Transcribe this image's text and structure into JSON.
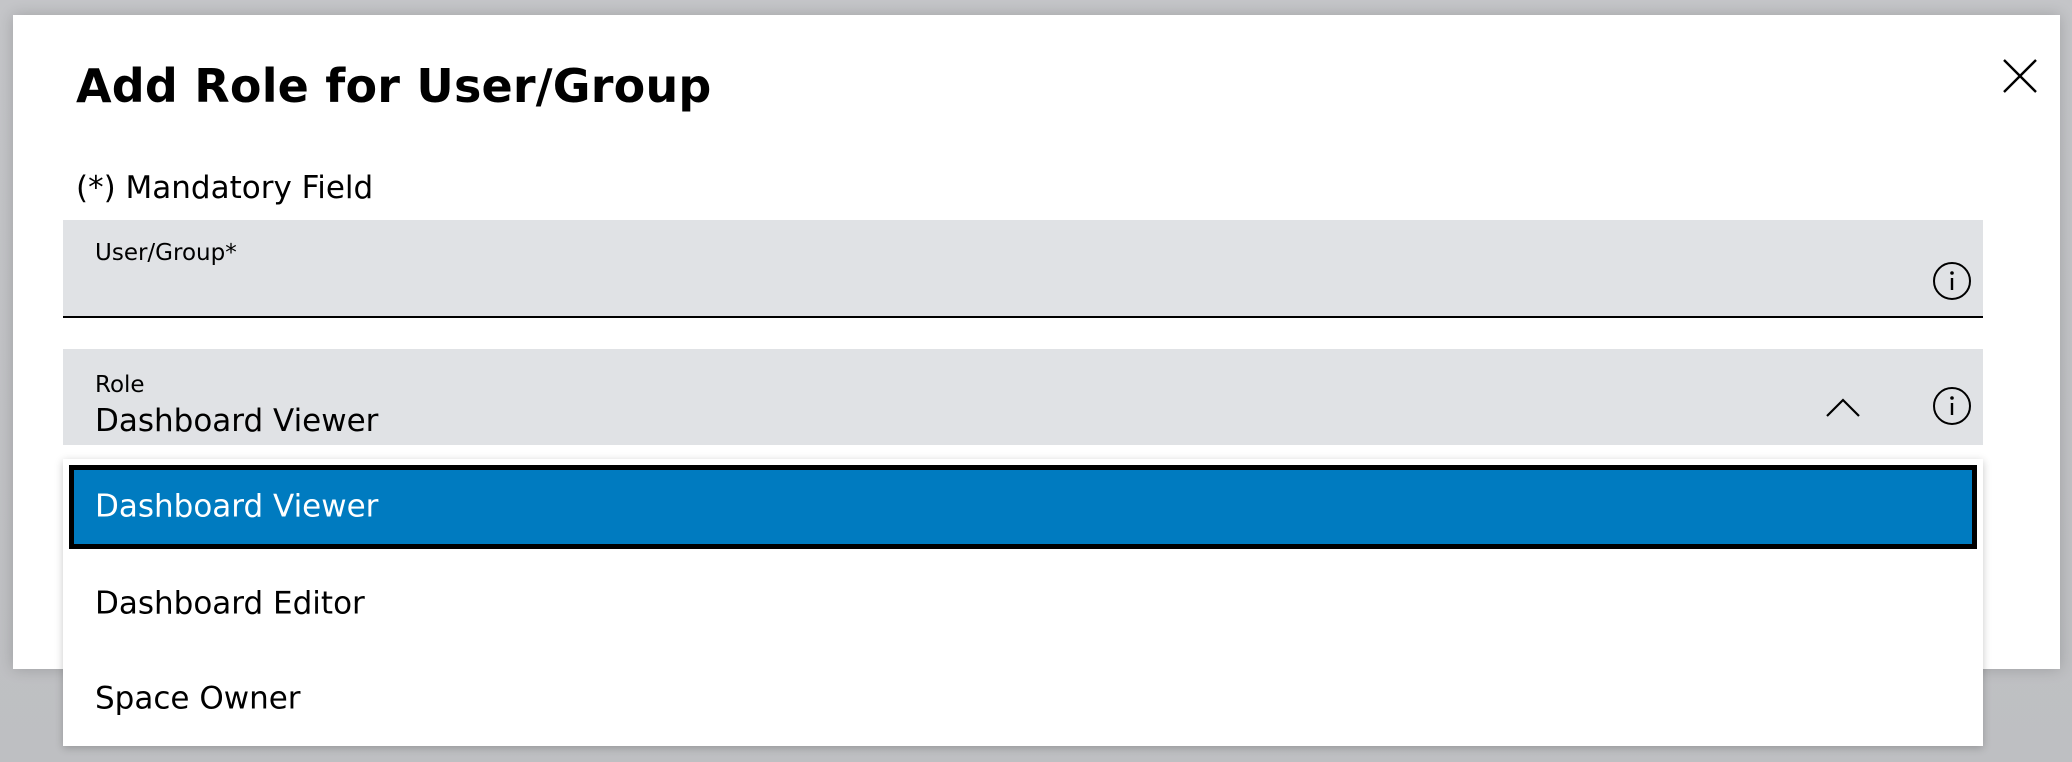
{
  "dialog": {
    "title": "Add Role for User/Group",
    "close_icon": "close-icon",
    "mandatory_note": "(*) Mandatory Field"
  },
  "fields": {
    "user_group": {
      "label": "User/Group*",
      "value": "",
      "info_icon": "info-icon"
    },
    "role": {
      "label": "Role",
      "value": "Dashboard Viewer",
      "chevron_icon": "chevron-up-icon",
      "info_icon": "info-icon"
    }
  },
  "role_dropdown": {
    "expanded": true,
    "selected": "Dashboard Viewer",
    "options": [
      "Dashboard Viewer",
      "Dashboard Editor",
      "Space Owner"
    ]
  },
  "colors": {
    "field_background": "#e0e2e5",
    "selected_option": "#007bc0",
    "selected_option_text": "#ffffff",
    "backdrop": "#bebfc2"
  }
}
